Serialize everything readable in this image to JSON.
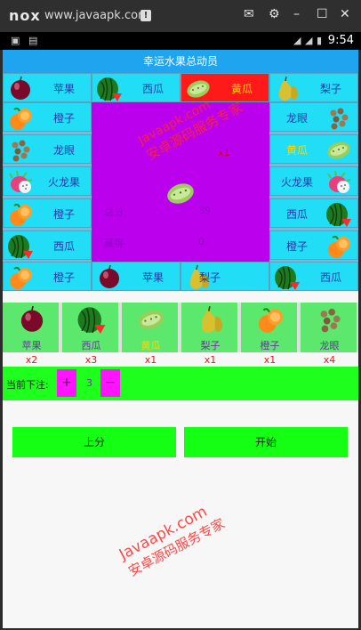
{
  "emulator": {
    "logo": "nox",
    "url": "www.javaapk.com",
    "info_icon": "info-icon",
    "controls": [
      "mail-icon",
      "gear-icon",
      "minimize-icon",
      "maximize-icon",
      "close-icon"
    ]
  },
  "status_bar": {
    "time": "9:54"
  },
  "app_title": "幸运水果总动员",
  "board": {
    "top_row": [
      {
        "fruit": "apple",
        "label": "苹果"
      },
      {
        "fruit": "watermelon",
        "label": "西瓜"
      },
      {
        "fruit": "cucumber",
        "label": "黄瓜",
        "active": true
      },
      {
        "fruit": "pear",
        "label": "梨子"
      }
    ],
    "left_col": [
      {
        "fruit": "orange",
        "label": "橙子"
      },
      {
        "fruit": "longan",
        "label": "龙眼"
      },
      {
        "fruit": "dragonfruit",
        "label": "火龙果"
      },
      {
        "fruit": "orange",
        "label": "橙子"
      },
      {
        "fruit": "watermelon",
        "label": "西瓜"
      }
    ],
    "right_col": [
      {
        "fruit": "longan",
        "label": "龙眼"
      },
      {
        "fruit": "cucumber",
        "label": "黄瓜"
      },
      {
        "fruit": "dragonfruit",
        "label": "火龙果"
      },
      {
        "fruit": "watermelon",
        "label": "西瓜"
      },
      {
        "fruit": "orange",
        "label": "橙子"
      }
    ],
    "bottom_row": [
      {
        "fruit": "orange",
        "label": "橙子"
      },
      {
        "fruit": "apple",
        "label": "苹果"
      },
      {
        "fruit": "pear",
        "label": "梨子"
      },
      {
        "fruit": "watermelon",
        "label": "西瓜"
      }
    ],
    "center": {
      "multiplier": "x1",
      "score_label": "总分",
      "score_value": "39",
      "win_label": "赢得",
      "win_value": "0",
      "fruit": "cucumber"
    }
  },
  "bet_options": [
    {
      "fruit": "apple",
      "label": "苹果",
      "multiplier": "x2"
    },
    {
      "fruit": "watermelon",
      "label": "西瓜",
      "multiplier": "x3"
    },
    {
      "fruit": "cucumber",
      "label": "黄瓜",
      "multiplier": "x1"
    },
    {
      "fruit": "pear",
      "label": "梨子",
      "multiplier": "x1"
    },
    {
      "fruit": "orange",
      "label": "橙子",
      "multiplier": "x1"
    },
    {
      "fruit": "longan",
      "label": "龙眼",
      "multiplier": "x4"
    }
  ],
  "stake": {
    "label": "当前下注:",
    "plus": "+",
    "value": "3",
    "minus": "−"
  },
  "actions": {
    "add_credit": "上分",
    "start": "开始"
  },
  "watermarks": [
    {
      "line1": "Javaapk.com",
      "line2": "安卓源码服务专家"
    },
    {
      "line1": "Javaapk.com",
      "line2": "安卓源码服务专家"
    }
  ],
  "colors": {
    "title_bar": "#1fa5f0",
    "cell": "#22ddf6",
    "active_cell": "#ff1a1a",
    "center": "#bb00ee",
    "bet_card": "#5ce86c",
    "button": "#14ff14",
    "stake_button": "#ff14ff"
  }
}
